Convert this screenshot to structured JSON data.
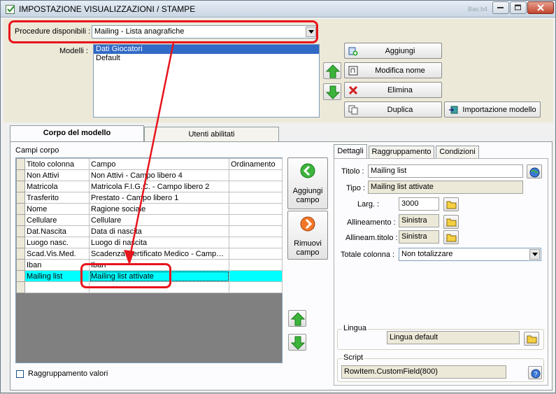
{
  "window": {
    "title": "IMPOSTAZIONE VISUALIZZAZIONI / STAMPE",
    "faded_text": "Bas.b4"
  },
  "procedure": {
    "label": "Procedure disponibili :",
    "selected": "Mailing - Lista anagrafiche"
  },
  "modelli": {
    "label": "Modelli :",
    "items": [
      "Dati Giocatori",
      "Default"
    ],
    "selected_index": 0
  },
  "model_buttons": {
    "aggiungi": "Aggiungi",
    "modifica_nome": "Modifica nome",
    "elimina": "Elimina",
    "duplica": "Duplica",
    "importazione": "Importazione modello"
  },
  "tabs": {
    "corpo": "Corpo del modello",
    "utenti": "Utenti abilitati"
  },
  "campi_corpo": {
    "label": "Campi corpo",
    "headers": [
      "Titolo colonna",
      "Campo",
      "Ordinamento"
    ],
    "rows": [
      {
        "titolo": "Non Attivi",
        "campo": "Non Attivi - Campo libero 4",
        "ordinamento": ""
      },
      {
        "titolo": "Matricola",
        "campo": "Matricola F.I.G.C. - Campo libero 2",
        "ordinamento": ""
      },
      {
        "titolo": "Trasferito",
        "campo": "Prestato - Campo libero 1",
        "ordinamento": ""
      },
      {
        "titolo": "Nome",
        "campo": "Ragione sociale",
        "ordinamento": ""
      },
      {
        "titolo": "Cellulare",
        "campo": "Cellulare",
        "ordinamento": ""
      },
      {
        "titolo": "Dat.Nascita",
        "campo": "Data di nascita",
        "ordinamento": ""
      },
      {
        "titolo": "Luogo nasc.",
        "campo": "Luogo di nascita",
        "ordinamento": ""
      },
      {
        "titolo": "Scad.Vis.Med.",
        "campo": "Scadenza Certificato Medico - Campo li...",
        "ordinamento": ""
      },
      {
        "titolo": "Iban",
        "campo": "Iban",
        "ordinamento": ""
      },
      {
        "titolo": "Mailing list",
        "campo": "Mailing list attivate",
        "ordinamento": ""
      }
    ],
    "highlighted_row": 9
  },
  "field_buttons": {
    "aggiungi_line1": "Aggiungi",
    "aggiungi_line2": "campo",
    "rimuovi_line1": "Rimuovi",
    "rimuovi_line2": "campo"
  },
  "raggruppamento_valori": {
    "label": "Raggruppamento valori",
    "checked": false
  },
  "detail_tabs": [
    "Dettagli",
    "Raggruppamento",
    "Condizioni"
  ],
  "dettagli": {
    "titolo_label": "Titolo :",
    "titolo_value": "Mailing list",
    "tipo_label": "Tipo :",
    "tipo_value": "Mailing list attivate",
    "larg_label": "Larg. :",
    "larg_value": "3000",
    "allineamento_label": "Allineamento :",
    "allineamento_value": "Sinistra",
    "allineam_titolo_label": "Allineam.titolo :",
    "allineam_titolo_value": "Sinistra",
    "totale_label": "Totale colonna :",
    "totale_value": "Non totalizzare",
    "lingua_label": "Lingua",
    "lingua_value": "Lingua default",
    "script_label": "Script",
    "script_value": "RowItem.CustomField(800)"
  },
  "colors": {
    "highlight": "#00ffff",
    "selection": "#316ac5",
    "annotation": "#e8141c"
  }
}
